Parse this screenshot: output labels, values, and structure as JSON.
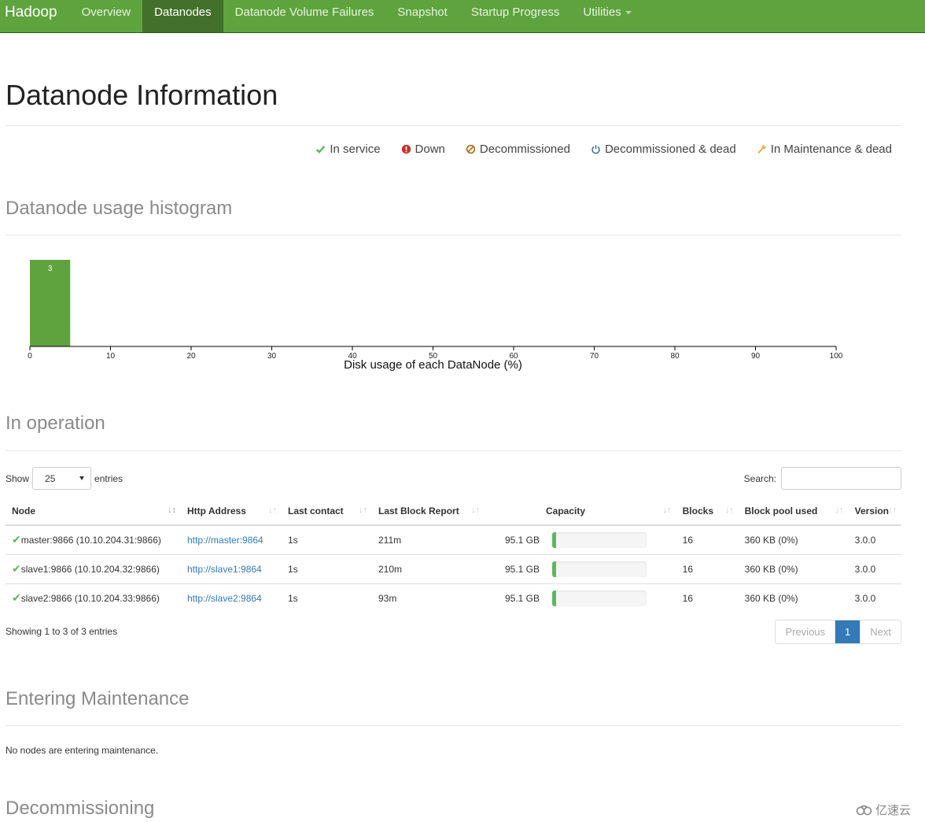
{
  "nav": {
    "brand": "Hadoop",
    "items": [
      {
        "label": "Overview",
        "active": false
      },
      {
        "label": "Datanodes",
        "active": true
      },
      {
        "label": "Datanode Volume Failures",
        "active": false
      },
      {
        "label": "Snapshot",
        "active": false
      },
      {
        "label": "Startup Progress",
        "active": false
      },
      {
        "label": "Utilities",
        "active": false,
        "dropdown": true
      }
    ]
  },
  "page_title": "Datanode Information",
  "legend": [
    {
      "icon": "check-icon",
      "label": "In service",
      "color": "#5cb85c"
    },
    {
      "icon": "exclamation-circle-icon",
      "label": "Down",
      "color": "#c9302c"
    },
    {
      "icon": "ban-icon",
      "label": "Decommissioned",
      "color": "#b06b1c"
    },
    {
      "icon": "power-icon",
      "label": "Decommissioned & dead",
      "color": "#3b6fa1"
    },
    {
      "icon": "wrench-icon",
      "label": "In Maintenance & dead",
      "color": "#f0a640"
    }
  ],
  "histogram": {
    "title": "Datanode usage histogram"
  },
  "chart_data": {
    "type": "bar",
    "title": "Datanode usage histogram",
    "xlabel": "Disk usage of each DataNode (%)",
    "ylabel": "",
    "xlim": [
      0,
      100
    ],
    "x_ticks": [
      0,
      10,
      20,
      30,
      40,
      50,
      60,
      70,
      80,
      90,
      100
    ],
    "bins": [
      {
        "range": [
          0,
          5
        ],
        "count": 3
      }
    ],
    "bar_color": "#5fa33e",
    "grid": false
  },
  "in_operation": {
    "title": "In operation",
    "show_label": "Show",
    "entries_label": "entries",
    "page_size": "25",
    "search_label": "Search:",
    "search_value": "",
    "columns": [
      "Node",
      "Http Address",
      "Last contact",
      "Last Block Report",
      "Capacity",
      "Blocks",
      "Block pool used",
      "Version"
    ],
    "rows": [
      {
        "node": "master:9866 (10.10.204.31:9866)",
        "http": "http://master:9864",
        "last_contact": "1s",
        "last_block_report": "211m",
        "capacity": "95.1 GB",
        "capacity_used_fraction": 0.01,
        "blocks": "16",
        "block_pool_used": "360 KB (0%)",
        "version": "3.0.0"
      },
      {
        "node": "slave1:9866 (10.10.204.32:9866)",
        "http": "http://slave1:9864",
        "last_contact": "1s",
        "last_block_report": "210m",
        "capacity": "95.1 GB",
        "capacity_used_fraction": 0.01,
        "blocks": "16",
        "block_pool_used": "360 KB (0%)",
        "version": "3.0.0"
      },
      {
        "node": "slave2:9866 (10.10.204.33:9866)",
        "http": "http://slave2:9864",
        "last_contact": "1s",
        "last_block_report": "93m",
        "capacity": "95.1 GB",
        "capacity_used_fraction": 0.01,
        "blocks": "16",
        "block_pool_used": "360 KB (0%)",
        "version": "3.0.0"
      }
    ],
    "info": "Showing 1 to 3 of 3 entries",
    "pager": {
      "previous": "Previous",
      "current": "1",
      "next": "Next"
    }
  },
  "entering_maintenance": {
    "title": "Entering Maintenance",
    "message": "No nodes are entering maintenance."
  },
  "decommissioning": {
    "title": "Decommissioning"
  },
  "watermark": "亿速云"
}
